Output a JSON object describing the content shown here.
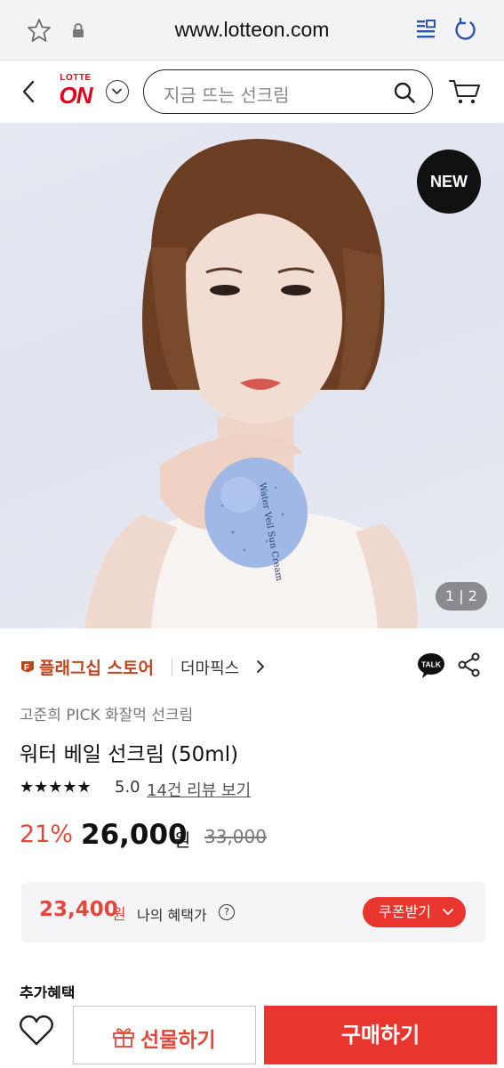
{
  "browser": {
    "url": "www.lotteon.com",
    "icons": [
      "star-icon",
      "lock-icon",
      "reader-icon",
      "reload-icon"
    ]
  },
  "header": {
    "logo_top": "LOTTE",
    "logo_main": "ON",
    "search_placeholder": "지금 뜨는 선크림",
    "icons": [
      "back-icon",
      "chevron-down-icon",
      "search-icon",
      "cart-icon"
    ]
  },
  "hero": {
    "badge": "NEW",
    "pager": "1 | 2",
    "product_label": "Water Veil Sun Cream"
  },
  "product": {
    "store_flagship": "플래그십 스토어",
    "brand": "더마픽스",
    "subtitle": "고준희 PICK 화잘먹 선크림",
    "title": "워터 베일 선크림 (50ml)",
    "stars": "★★★★★",
    "rating": "5.0",
    "reviews_link": "14건 리뷰 보기",
    "discount": "21%",
    "price": "26,000",
    "won": "원",
    "original_price": "33,000"
  },
  "benefit": {
    "price": "23,400",
    "won": "원",
    "label": "나의 혜택가",
    "info": "?",
    "coupon": "쿠폰받기"
  },
  "extra_label": "추가혜택",
  "bottom": {
    "gift_label": "선물하기",
    "buy_label": "구매하기"
  },
  "colors": {
    "accent": "#e8352d",
    "store_orange": "#c0441e",
    "discount": "#e2473b"
  }
}
